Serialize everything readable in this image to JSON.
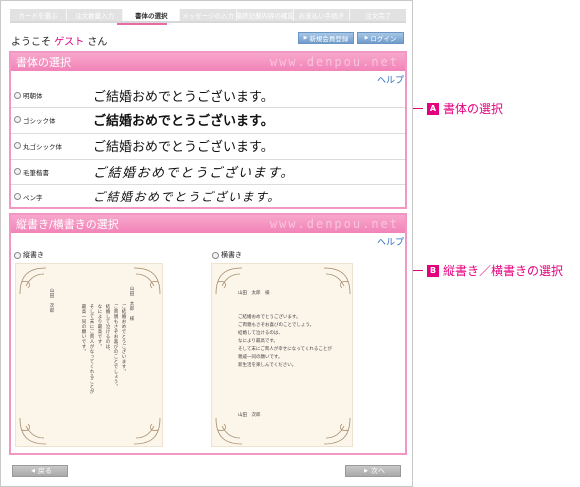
{
  "steps": [
    "カードを選ぶ",
    "注文数量入力",
    "書体の選択",
    "メッセージの入力",
    "最終記載内容の確認",
    "お支払い手続き",
    "注文完了"
  ],
  "active_step": 2,
  "header": {
    "welcome_prefix": "ようこそ",
    "guest_name": "ゲスト",
    "welcome_suffix": "さん",
    "register_label": "新規会員登録",
    "login_label": "ログイン"
  },
  "font_section": {
    "title": "書体の選択",
    "watermark": "www.denpou.net",
    "help": "ヘルプ",
    "options": [
      {
        "name": "明朝体",
        "sample": "ご結婚おめでとうございます。"
      },
      {
        "name": "ゴシック体",
        "sample": "ご結婚おめでとうございます。"
      },
      {
        "name": "丸ゴシック体",
        "sample": "ご結婚おめでとうございます。"
      },
      {
        "name": "毛筆楷書",
        "sample": "ご結婚おめでとうございます。"
      },
      {
        "name": "ペン字",
        "sample": "ご結婚おめでとうございます。"
      }
    ]
  },
  "layout_section": {
    "title": "縦書き/横書きの選択",
    "watermark": "www.denpou.net",
    "help": "ヘルプ",
    "vertical": {
      "label": "縦書き",
      "to_name": "山田　太郎　様",
      "body": [
        "ご結婚おめでとうございます。",
        "ご両親もさぞお喜びのことでしょう。",
        "結婚して泣けるのは、",
        "なにより最高です。",
        "そして末にご両人がなってくれることが",
        "最高一同の願いです。"
      ],
      "from_name": "山田　次郎"
    },
    "horizontal": {
      "label": "横書き",
      "to_name": "山田　太郎　様",
      "body": [
        "ご結婚おめでとうございます。",
        "ご両親もさぞお喜びのことでしょう。",
        "結婚して泣けるのは、",
        "なにより最高です。",
        "そして末にご両人が幸せになってくれることが",
        "親戚一同の願いです。",
        "新生活を楽しんでください。"
      ],
      "from_name": "山田　次郎"
    }
  },
  "nav": {
    "back_label": "戻る",
    "next_label": "次へ"
  },
  "callouts": [
    {
      "badge": "A",
      "text": "書体の選択"
    },
    {
      "badge": "B",
      "text": "縦書き／横書きの選択"
    }
  ],
  "colors": {
    "accent_pink": "#e3007f",
    "panel_pink": "#f296c4",
    "help_blue": "#2d6cc0"
  }
}
